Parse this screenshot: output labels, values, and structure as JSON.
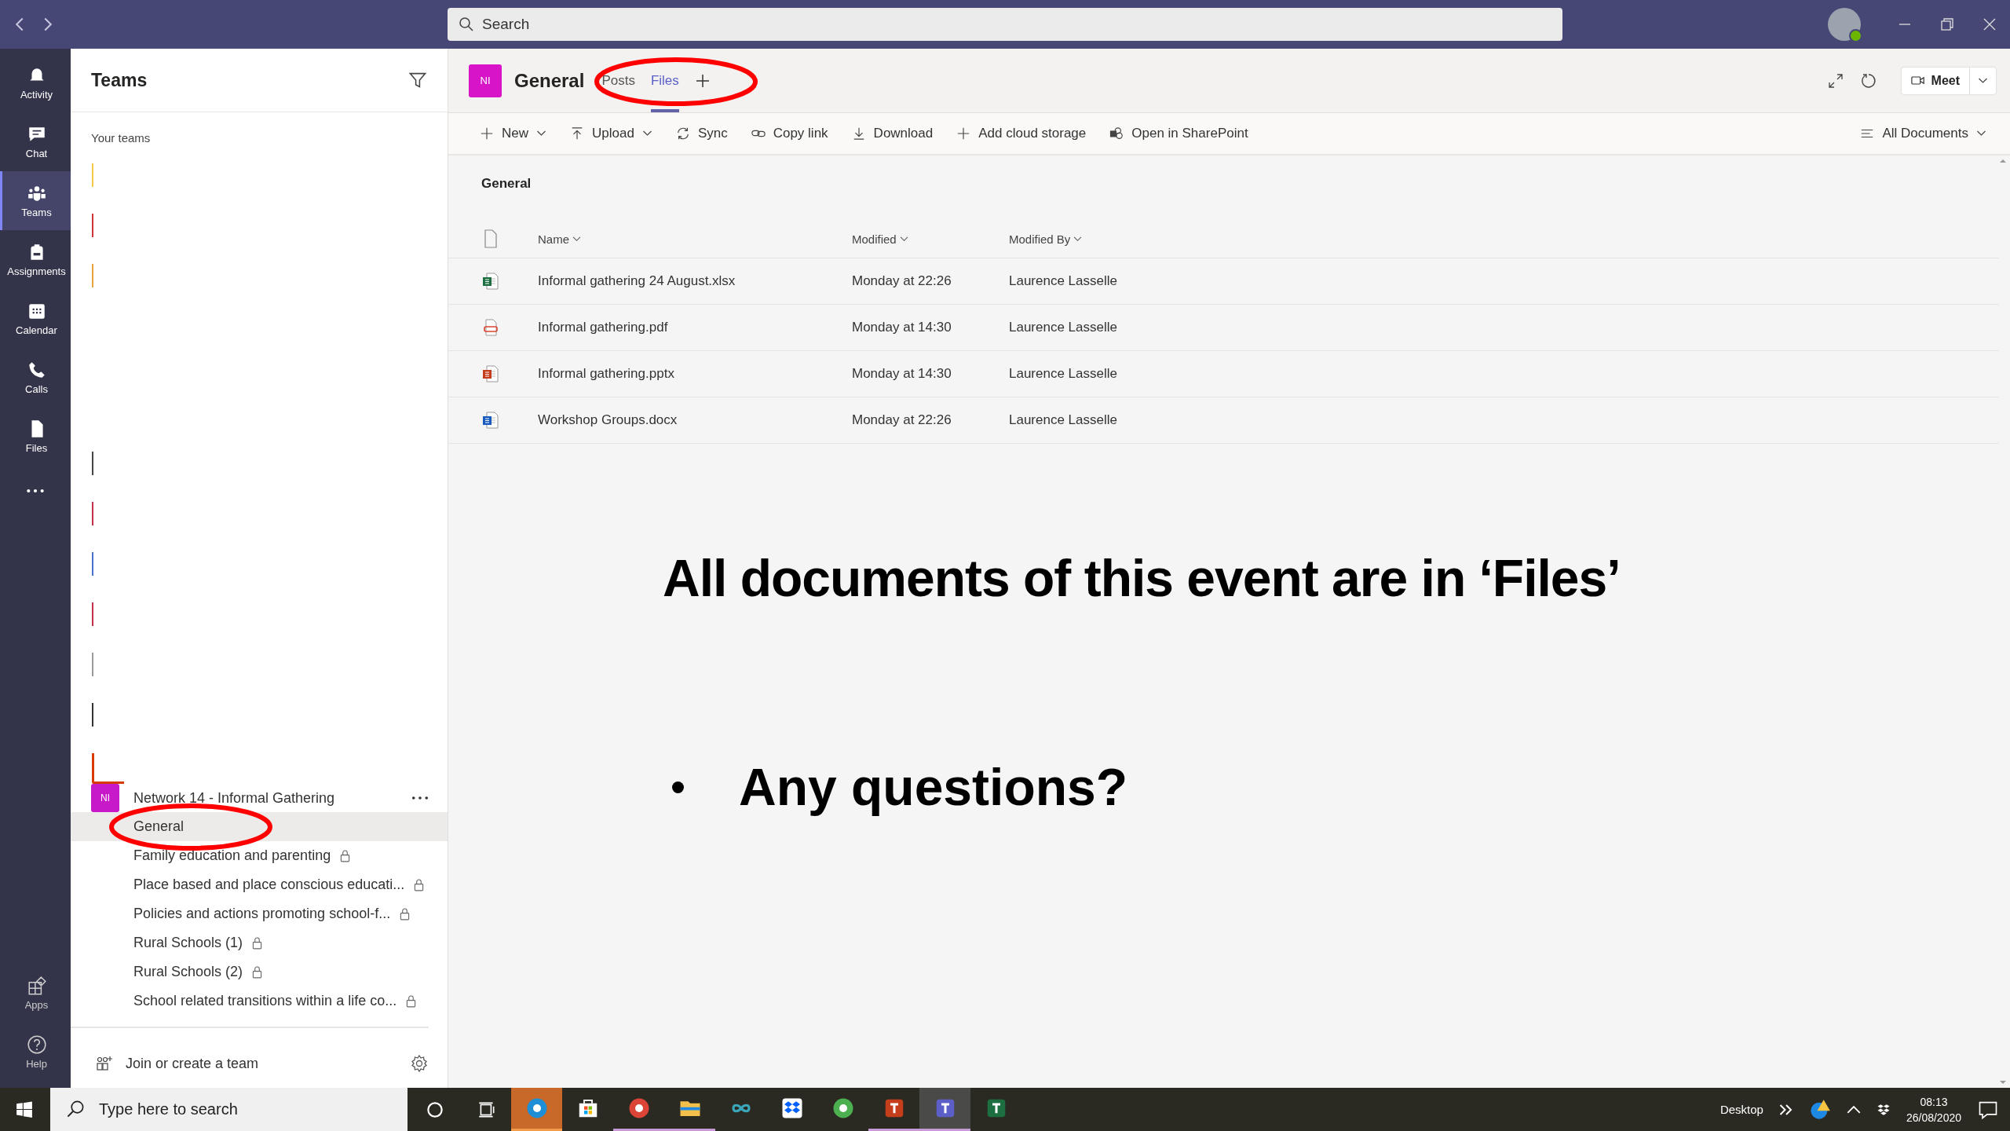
{
  "search": {
    "placeholder": "Search"
  },
  "rail": [
    {
      "label": "Activity",
      "kind": "bell",
      "selected": false
    },
    {
      "label": "Chat",
      "kind": "chat",
      "selected": false
    },
    {
      "label": "Teams",
      "kind": "teams",
      "selected": true
    },
    {
      "label": "Assignments",
      "kind": "bag",
      "selected": false
    },
    {
      "label": "Calendar",
      "kind": "calendar",
      "selected": false
    },
    {
      "label": "Calls",
      "kind": "phone",
      "selected": false
    },
    {
      "label": "Files",
      "kind": "file",
      "selected": false
    }
  ],
  "rail_bottom": [
    {
      "label": "Apps",
      "kind": "apps"
    },
    {
      "label": "Help",
      "kind": "help"
    }
  ],
  "sidebar": {
    "title": "Teams",
    "section": "Your teams",
    "team_fragments": [
      {
        "kind": "line",
        "color": "#f2c94c"
      },
      {
        "kind": "line",
        "color": "#d13438"
      },
      {
        "kind": "line",
        "color": "#e8a33c"
      },
      {
        "kind": "line",
        "color": "#444444"
      },
      {
        "kind": "line",
        "color": "#c4314b"
      },
      {
        "kind": "line",
        "color": "#4a6fcf"
      },
      {
        "kind": "line",
        "color": "#c4314b"
      },
      {
        "kind": "line",
        "color": "#999999"
      },
      {
        "kind": "line",
        "color": "#333333"
      },
      {
        "kind": "corner",
        "color": "#d83b01"
      }
    ],
    "team": {
      "avatar": "NI",
      "name": "Network 14 - Informal Gathering",
      "channels": [
        {
          "name": "General",
          "selected": true,
          "locked": false,
          "circled": true
        },
        {
          "name": "Family education and parenting",
          "selected": false,
          "locked": true,
          "circled": false
        },
        {
          "name": "Place based and place conscious educati...",
          "selected": false,
          "locked": true,
          "circled": false
        },
        {
          "name": "Policies and actions promoting school-f...",
          "selected": false,
          "locked": true,
          "circled": false
        },
        {
          "name": "Rural Schools (1)",
          "selected": false,
          "locked": true,
          "circled": false
        },
        {
          "name": "Rural Schools (2)",
          "selected": false,
          "locked": true,
          "circled": false
        },
        {
          "name": "School related transitions within a life co...",
          "selected": false,
          "locked": true,
          "circled": false
        }
      ]
    },
    "join": "Join or create a team"
  },
  "channel_header": {
    "avatar": "NI",
    "title": "General",
    "circled": true,
    "tabs": [
      {
        "label": "Posts",
        "selected": false
      },
      {
        "label": "Files",
        "selected": true
      }
    ],
    "meet": "Meet"
  },
  "toolbar": {
    "actions": [
      {
        "label": "New",
        "kind": "plus",
        "dropdown": true
      },
      {
        "label": "Upload",
        "kind": "upload",
        "dropdown": true
      },
      {
        "label": "Sync",
        "kind": "sync",
        "dropdown": false
      },
      {
        "label": "Copy link",
        "kind": "link",
        "dropdown": false
      },
      {
        "label": "Download",
        "kind": "download",
        "dropdown": false
      },
      {
        "label": "Add cloud storage",
        "kind": "plus",
        "dropdown": false
      },
      {
        "label": "Open in SharePoint",
        "kind": "sharepoint",
        "dropdown": false
      }
    ],
    "view": "All Documents"
  },
  "files": {
    "folder": "General",
    "columns": [
      "Name",
      "Modified",
      "Modified By"
    ],
    "rows": [
      {
        "kind": "xlsx",
        "name": "Informal gathering 24 August.xlsx",
        "modified": "Monday at 22:26",
        "modified_by": "Laurence Lasselle"
      },
      {
        "kind": "pdf",
        "name": "Informal gathering.pdf",
        "modified": "Monday at 14:30",
        "modified_by": "Laurence Lasselle"
      },
      {
        "kind": "pptx",
        "name": "Informal gathering.pptx",
        "modified": "Monday at 14:30",
        "modified_by": "Laurence Lasselle"
      },
      {
        "kind": "docx",
        "name": "Workshop Groups.docx",
        "modified": "Monday at 22:26",
        "modified_by": "Laurence Lasselle"
      }
    ]
  },
  "slide_overlay": {
    "heading": "All documents of this event are in ‘Files’",
    "bullets": [
      "Any questions?"
    ]
  },
  "taskbar": {
    "search": {
      "placeholder": "Type here to search"
    },
    "apps": [
      {
        "kind": "edge",
        "running": true,
        "selected": false,
        "flashing": true
      },
      {
        "kind": "store",
        "running": false,
        "selected": false,
        "flashing": false
      },
      {
        "kind": "chrome",
        "running": true,
        "selected": false,
        "flashing": false
      },
      {
        "kind": "explorer",
        "running": true,
        "selected": false,
        "flashing": false
      },
      {
        "kind": "infinity",
        "running": false,
        "selected": false,
        "flashing": false
      },
      {
        "kind": "dropbox",
        "running": false,
        "selected": false,
        "flashing": false
      },
      {
        "kind": "globe",
        "running": false,
        "selected": false,
        "flashing": false
      },
      {
        "kind": "powerpoint",
        "running": true,
        "selected": false,
        "flashing": false
      },
      {
        "kind": "teams",
        "running": true,
        "selected": true,
        "flashing": false
      },
      {
        "kind": "excel",
        "running": false,
        "selected": false,
        "flashing": false
      }
    ],
    "desktop": "Desktop",
    "time": "08:13",
    "date": "26/08/2020"
  }
}
